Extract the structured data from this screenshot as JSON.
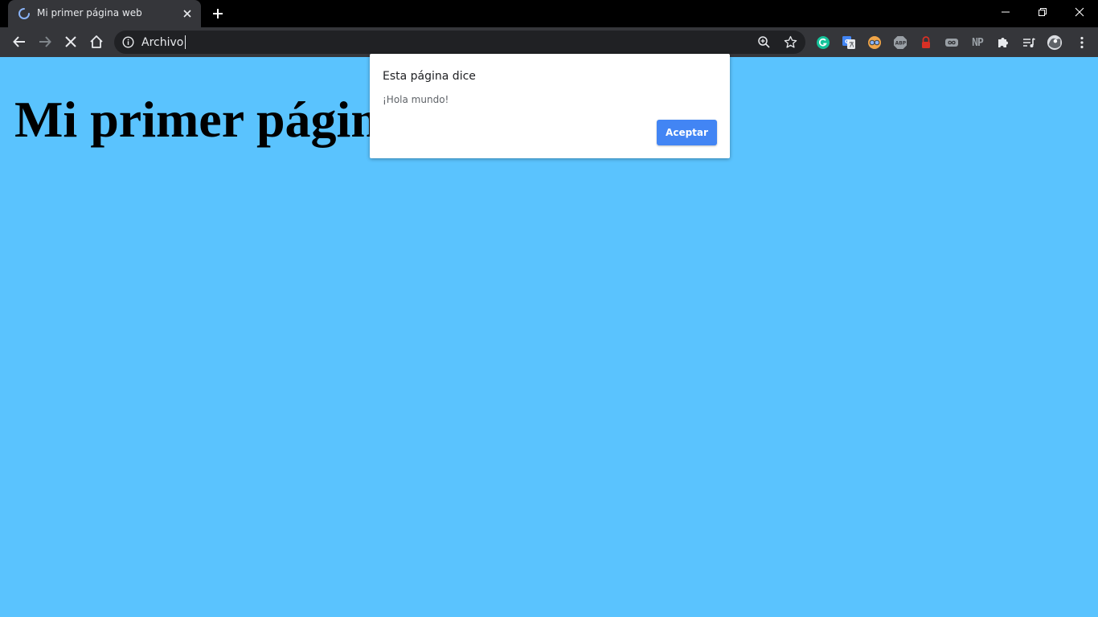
{
  "browser": {
    "tab": {
      "title": "Mi primer página web",
      "state": "loading"
    },
    "new_tab_icon": "plus-icon",
    "window_controls": [
      "minimize-icon",
      "restore-icon",
      "close-icon"
    ],
    "omnibox": {
      "text": "Archivo",
      "security_icon": "info-icon"
    },
    "extensions": [
      "grammarly-icon",
      "translate-icon",
      "glasses-icon",
      "adblock-icon",
      "lock-icon",
      "infinity-icon",
      "np-icon",
      "puzzle-icon",
      "media-icon",
      "avatar-icon",
      "menu-icon"
    ],
    "np_label": "NP"
  },
  "page": {
    "heading": "Mi primer página web",
    "background_color": "#5ac3fe"
  },
  "dialog": {
    "title": "Esta página dice",
    "message": "¡Hola mundo!",
    "ok_label": "Aceptar",
    "accent_color": "#4285f4"
  }
}
